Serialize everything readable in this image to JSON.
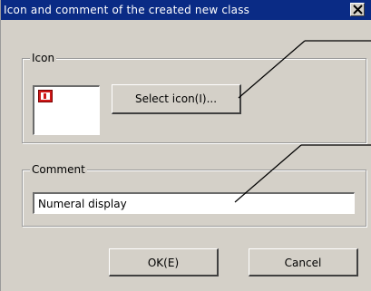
{
  "window": {
    "title": "Icon and comment of the created new class",
    "close_glyph": "✕"
  },
  "icon_group": {
    "label": "Icon",
    "select_button": "Select icon(I)..."
  },
  "comment_group": {
    "label": "Comment",
    "value": "Numeral display"
  },
  "buttons": {
    "ok": "OK(E)",
    "cancel": "Cancel"
  },
  "colors": {
    "titlebar": "#0a2b85",
    "face": "#d4d0c8",
    "icon_red": "#d01818"
  }
}
